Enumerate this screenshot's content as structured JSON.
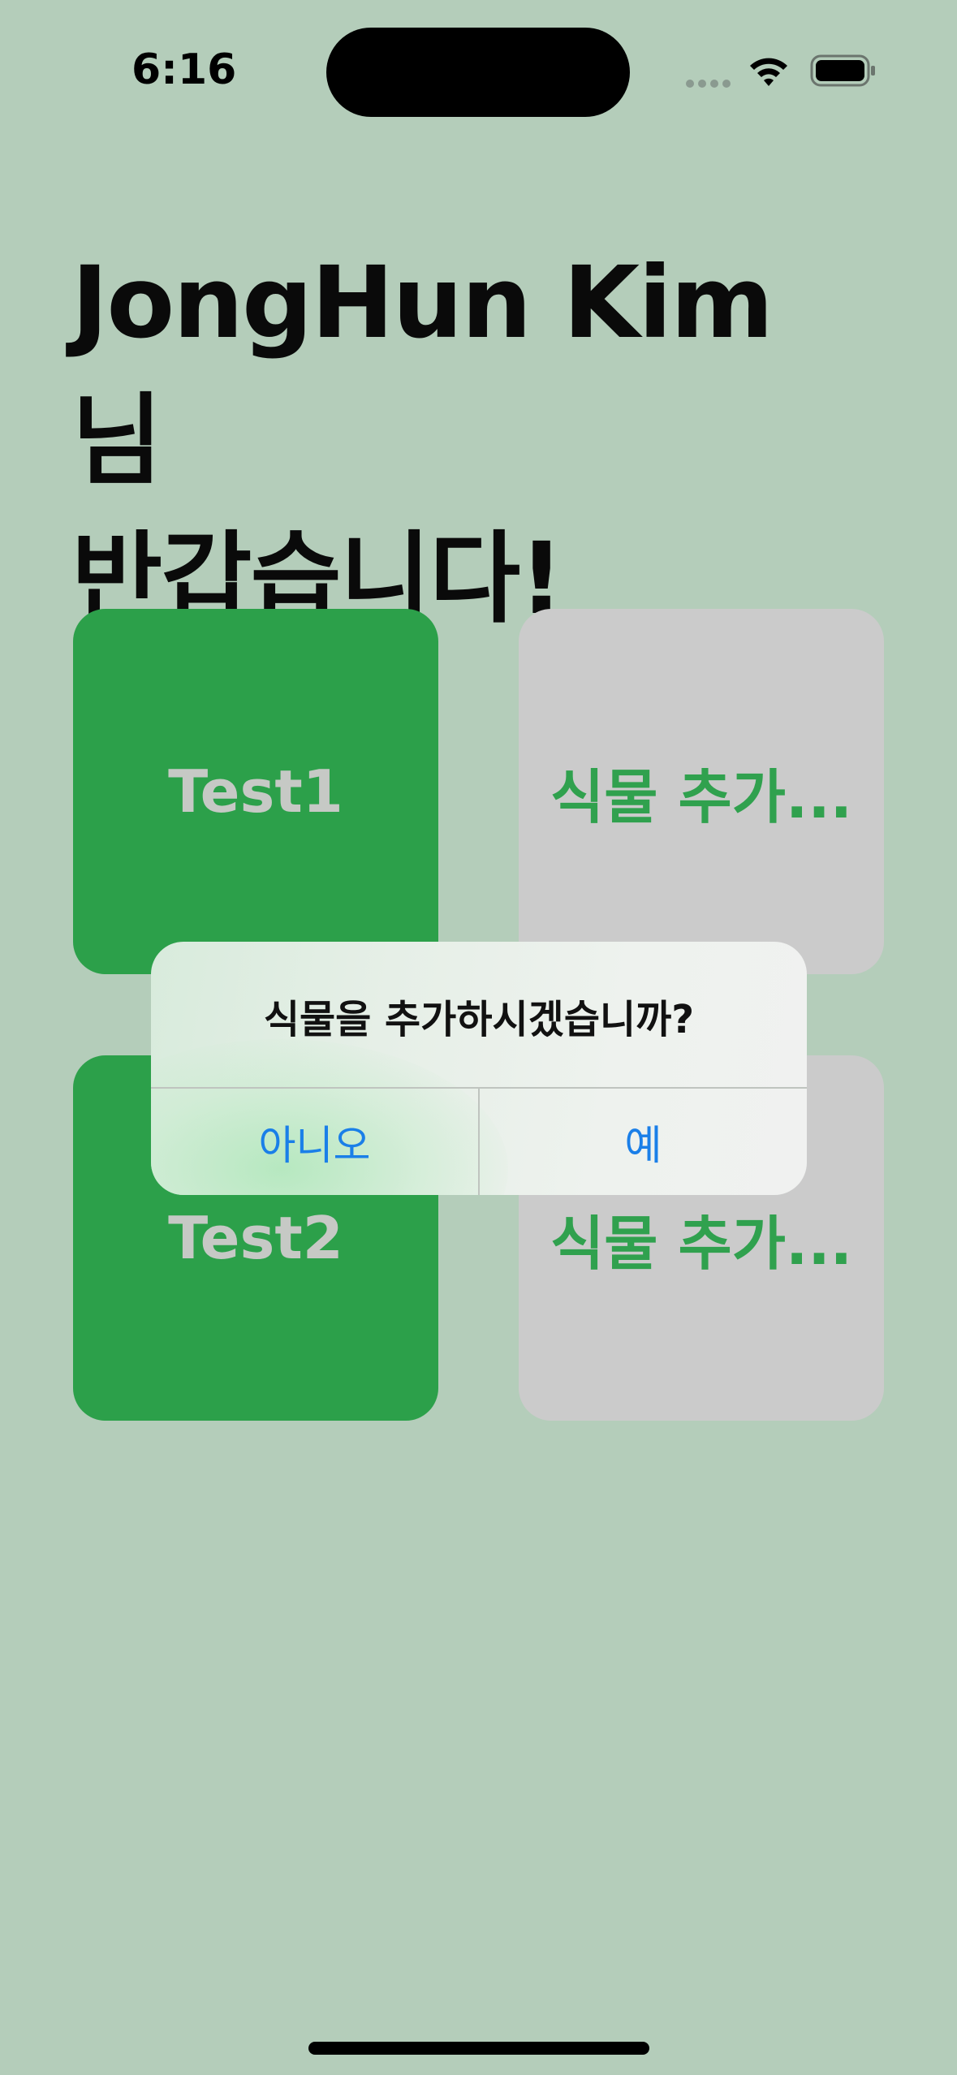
{
  "status_bar": {
    "time": "6:16",
    "icons": [
      "cellular-signal-icon",
      "wifi-icon",
      "battery-icon"
    ]
  },
  "header": {
    "greeting_line1": "JongHun Kim 님",
    "greeting_line2": "반갑습니다!"
  },
  "plants": [
    {
      "label": "Test1",
      "type": "plant"
    },
    {
      "label": "식물 추가...",
      "type": "add"
    },
    {
      "label": "Test2",
      "type": "plant"
    },
    {
      "label": "식물 추가...",
      "type": "add"
    }
  ],
  "alert": {
    "title": "식물을 추가하시겠습니까?",
    "cancel_label": "아니오",
    "confirm_label": "예"
  },
  "colors": {
    "background": "#b4cdba",
    "plant_card": "#2ca04a",
    "add_card": "#cbcbcb",
    "accent_text": "#30a14e",
    "alert_button": "#1a7fe8"
  }
}
